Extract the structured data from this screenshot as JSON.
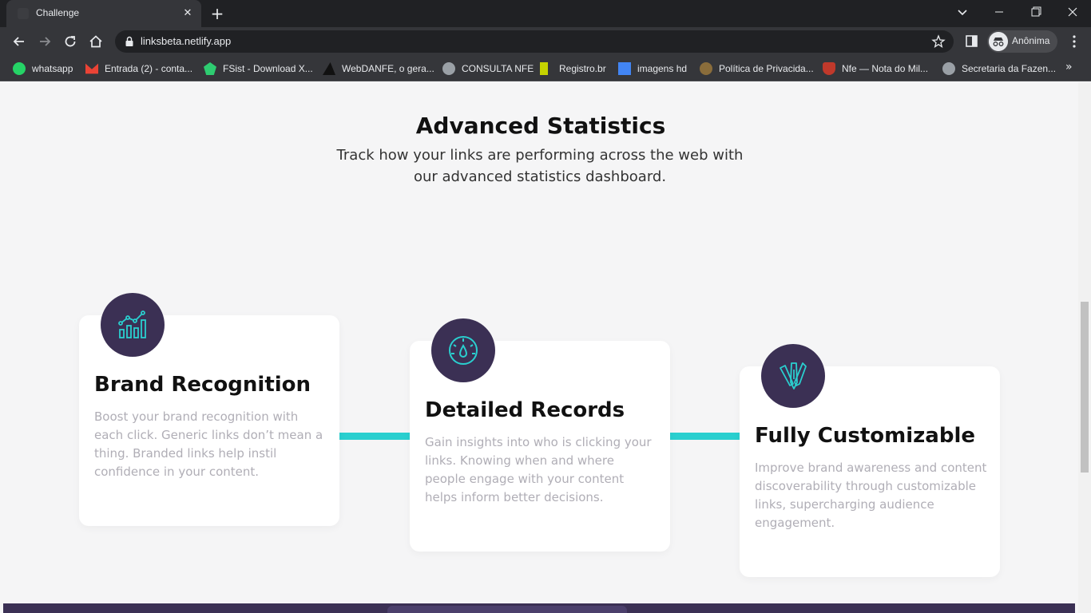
{
  "browser": {
    "tab_title": "Challenge",
    "tab_close": "✕",
    "new_tab": "+",
    "url": "linksbeta.netlify.app",
    "profile_label": "Anônima",
    "bookmarks": [
      {
        "label": "whatsapp",
        "icon": "whatsapp-icon",
        "color": "#25d366"
      },
      {
        "label": "Entrada (2) - conta...",
        "icon": "gmail-icon",
        "color": "#ea4335"
      },
      {
        "label": "FSist - Download X...",
        "icon": "fsist-icon",
        "color": "#2ecc71"
      },
      {
        "label": "WebDANFE, o gera...",
        "icon": "webdanfe-icon",
        "color": "#111111"
      },
      {
        "label": "CONSULTA NFE",
        "icon": "globe-icon",
        "color": "#9aa0a6"
      },
      {
        "label": "Registro.br",
        "icon": "registro-icon",
        "color": "#c5d300"
      },
      {
        "label": "imagens hd",
        "icon": "imagens-icon",
        "color": "#4285f4"
      },
      {
        "label": "Política de Privacida...",
        "icon": "privacy-icon",
        "color": "#8a6d3b"
      },
      {
        "label": "Nfe — Nota do Mil...",
        "icon": "nfe-icon",
        "color": "#c0392b"
      },
      {
        "label": "Secretaria da Fazen...",
        "icon": "globe-icon",
        "color": "#9aa0a6"
      }
    ],
    "bookmarks_more": "»"
  },
  "section": {
    "title": "Advanced Statistics",
    "subtitle": "Track how your links are performing across the web with our advanced statistics dashboard."
  },
  "cards": [
    {
      "title": "Brand Recognition",
      "description": "Boost your brand recognition with each click. Generic links don’t mean a thing. Branded links help instil confidence in your content.",
      "icon": "chart-icon"
    },
    {
      "title": "Detailed Records",
      "description": "Gain insights into who is clicking your links. Knowing when and where people engage with your content helps inform better decisions.",
      "icon": "gauge-icon"
    },
    {
      "title": "Fully Customizable",
      "description": "Improve brand awareness and content discoverability through customizable links, supercharging audience engagement.",
      "icon": "brush-pen-icon"
    }
  ],
  "colors": {
    "accent_cyan": "#2acfcf",
    "dark_violet": "#3b3054",
    "grayish_violet": "#b0aeb6"
  }
}
